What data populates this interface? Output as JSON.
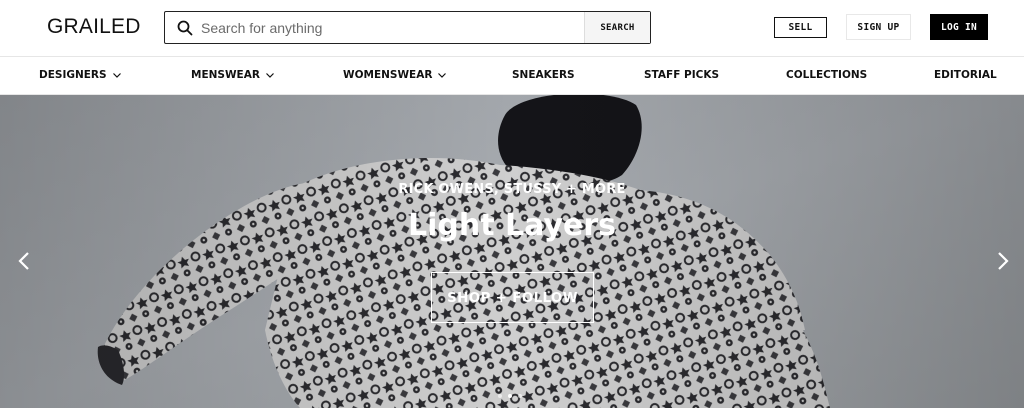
{
  "header": {
    "logo": "GRAILED",
    "search": {
      "placeholder": "Search for anything",
      "button_label": "SEARCH"
    },
    "sell_label": "SELL",
    "signup_label": "SIGN UP",
    "login_label": "LOG IN"
  },
  "nav": {
    "items": [
      {
        "label": "DESIGNERS",
        "has_dropdown": true
      },
      {
        "label": "MENSWEAR",
        "has_dropdown": true
      },
      {
        "label": "WOMENSWEAR",
        "has_dropdown": true
      },
      {
        "label": "SNEAKERS",
        "has_dropdown": false
      },
      {
        "label": "STAFF PICKS",
        "has_dropdown": false
      },
      {
        "label": "COLLECTIONS",
        "has_dropdown": false
      },
      {
        "label": "EDITORIAL",
        "has_dropdown": false
      }
    ]
  },
  "hero": {
    "kicker": "RICK OWENS, STUSSY + MORE",
    "headline": "Light Layers",
    "cta_label": "SHOP + FOLLOW",
    "slide_count": 3,
    "active_slide": 2
  },
  "colors": {
    "brand": "#000000",
    "hero_bg": "#a2a6ab",
    "hero_text": "#ffffff"
  },
  "icons": {
    "search": "search-icon",
    "chevron": "chevron-down-icon",
    "prev": "chevron-left-icon",
    "next": "chevron-right-icon"
  }
}
